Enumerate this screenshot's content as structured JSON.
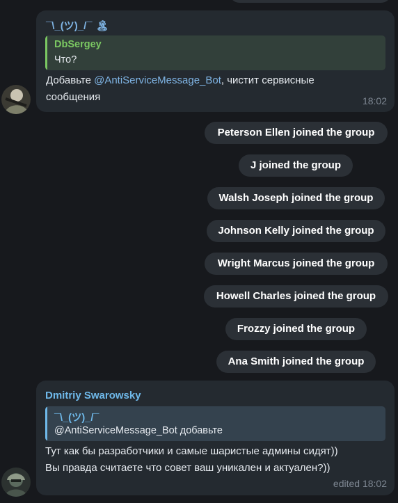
{
  "messages": [
    {
      "sender": "¯\\_(ツ)_/¯",
      "sender_emoji": "🏝",
      "reply": {
        "author": "DbSergey",
        "text": "Что?"
      },
      "text_before": "Добавьте ",
      "mention": "@AntiServiceMessage_Bot",
      "text_after": ", чистит сервисные",
      "text_line2": "сообщения",
      "time": "18:02"
    },
    {
      "sender": "Dmitriy Swarowsky",
      "reply": {
        "author": "¯\\_(ツ)_/¯",
        "text": "@AntiServiceMessage_Bot добавьте"
      },
      "text_line1": "Тут как бы разработчики и самые шаристые админы сидят))",
      "text_line2": "Вы правда считаете что совет ваш уникален и актуален?))",
      "time": "edited 18:02"
    }
  ],
  "service_messages": [
    "Peterson Ellen joined the group",
    "J joined the group",
    "Walsh Joseph joined the group",
    "Johnson Kelly joined the group",
    "Wright Marcus joined the group",
    "Howell Charles joined the group",
    "Frozzy joined the group",
    "Ana Smith joined the group"
  ],
  "colors": {
    "background": "#17191d",
    "bubble": "#242a30",
    "service_pill": "#2b3036",
    "sender_1": "#7fb4e4",
    "reply_green": "#7bc862",
    "sender_2": "#6fb9ea",
    "timestamp": "#7e8792"
  }
}
